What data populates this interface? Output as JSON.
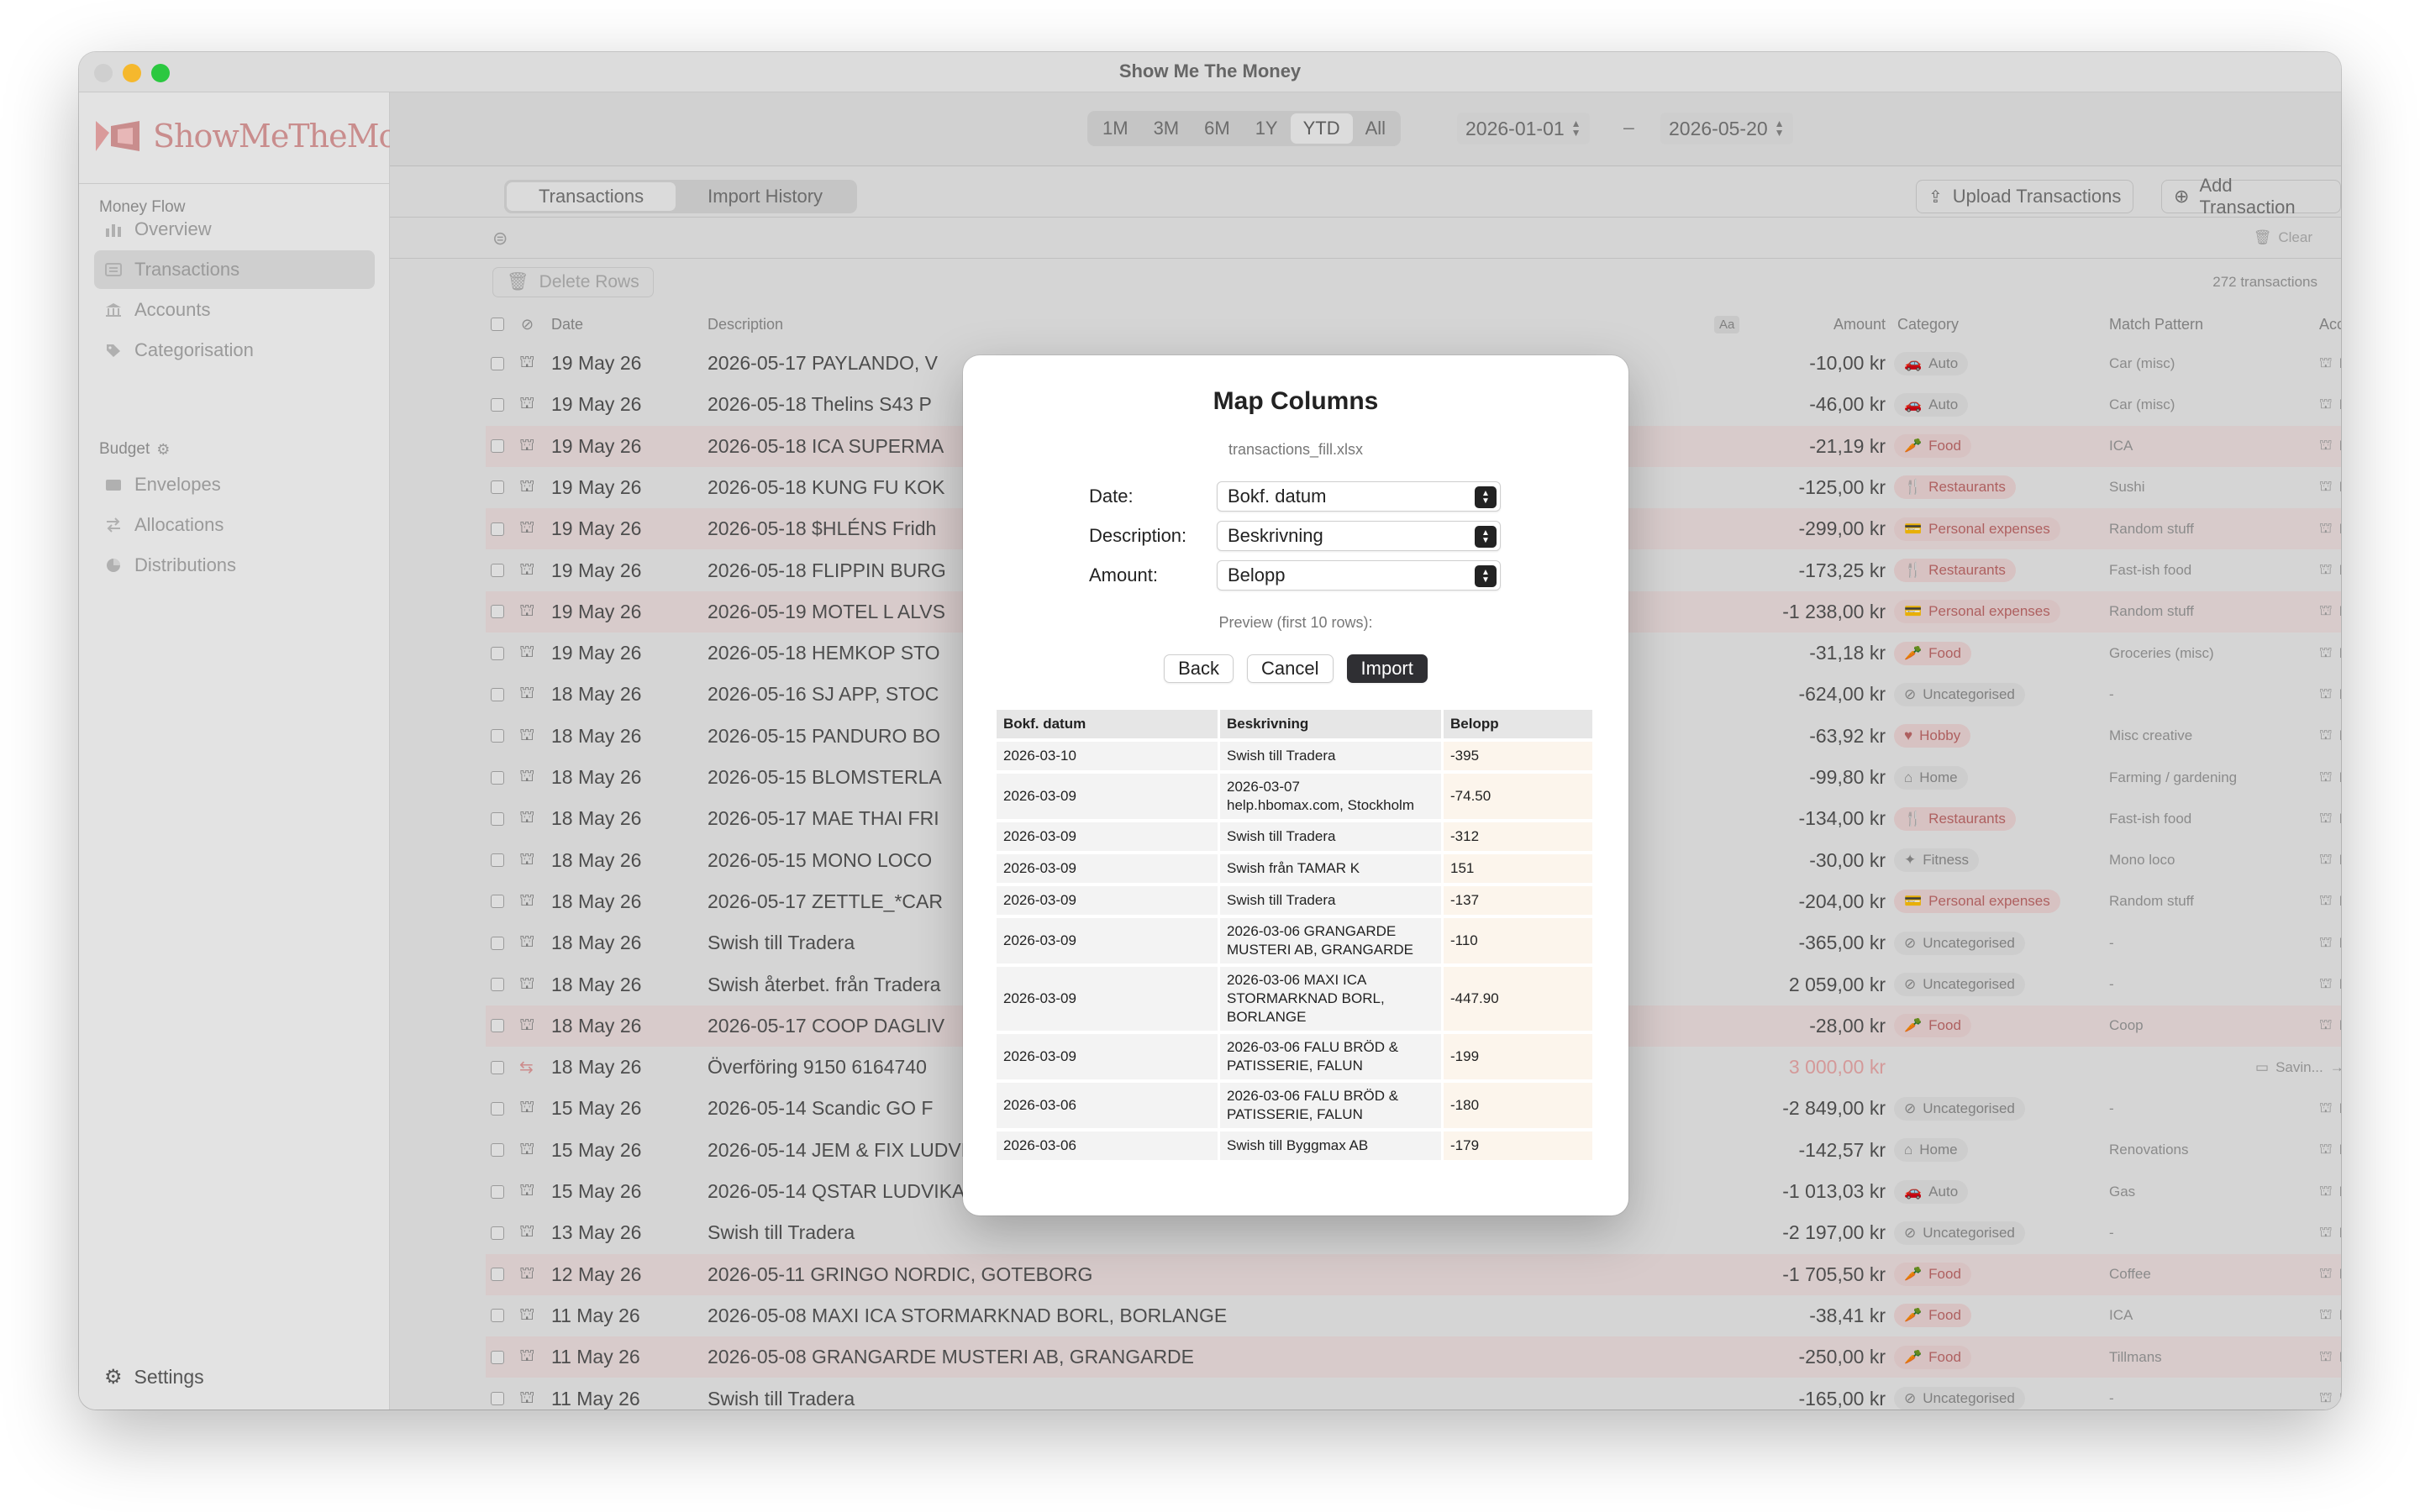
{
  "window": {
    "title": "Show Me The Money"
  },
  "sidebar": {
    "logo_text": "ShowMeTheMoney",
    "sections": [
      {
        "label": "Money Flow",
        "items": [
          {
            "label": "Overview",
            "icon": "chart-bars-icon"
          },
          {
            "label": "Transactions",
            "icon": "list-icon",
            "active": true
          },
          {
            "label": "Accounts",
            "icon": "bank-icon"
          },
          {
            "label": "Categorisation",
            "icon": "tag-icon"
          }
        ]
      },
      {
        "label": "Budget",
        "items": [
          {
            "label": "Envelopes",
            "icon": "envelope-icon"
          },
          {
            "label": "Allocations",
            "icon": "arrows-icon"
          },
          {
            "label": "Distributions",
            "icon": "pie-icon"
          }
        ]
      }
    ],
    "settings_label": "Settings"
  },
  "toolbar": {
    "ranges": [
      "1M",
      "3M",
      "6M",
      "1Y",
      "YTD",
      "All"
    ],
    "selected_range": "YTD",
    "date_from": "2026-01-01",
    "date_sep": "–",
    "date_to": "2026-05-20"
  },
  "tabs": {
    "transactions": "Transactions",
    "import_history": "Import History"
  },
  "actions": {
    "upload": "Upload Transactions",
    "add": "Add Transaction"
  },
  "filter": {
    "clear": "Clear"
  },
  "list": {
    "delete_label": "Delete Rows",
    "count": "272 transactions",
    "headers": {
      "date": "Date",
      "description": "Description",
      "aa": "Aa",
      "amount": "Amount",
      "category": "Category",
      "match": "Match Pattern",
      "account": "Account"
    },
    "rows": [
      {
        "date": "19 May 26",
        "desc": "2026-05-17 PAYLANDO, V",
        "amount": "-10,00 kr",
        "cat": "Auto",
        "match": "Car (misc)",
        "acct": "Debit",
        "pink": false,
        "red": false
      },
      {
        "date": "19 May 26",
        "desc": "2026-05-18 Thelins S43 P",
        "amount": "-46,00 kr",
        "cat": "Auto",
        "match": "Car (misc)",
        "acct": "Debit",
        "pink": false,
        "red": false
      },
      {
        "date": "19 May 26",
        "desc": "2026-05-18 ICA SUPERMA",
        "amount": "-21,19 kr",
        "cat": "Food",
        "match": "ICA",
        "acct": "Debit",
        "pink": true,
        "red": true
      },
      {
        "date": "19 May 26",
        "desc": "2026-05-18 KUNG FU KOK",
        "amount": "-125,00 kr",
        "cat": "Restaurants",
        "match": "Sushi",
        "acct": "Debit",
        "pink": false,
        "red": true
      },
      {
        "date": "19 May 26",
        "desc": "2026-05-18 $HLÉNS Fridh",
        "amount": "-299,00 kr",
        "cat": "Personal expenses",
        "match": "Random stuff",
        "acct": "Debit",
        "pink": true,
        "red": true
      },
      {
        "date": "19 May 26",
        "desc": "2026-05-18 FLIPPIN BURG",
        "amount": "-173,25 kr",
        "cat": "Restaurants",
        "match": "Fast-ish food",
        "acct": "Debit",
        "pink": false,
        "red": true
      },
      {
        "date": "19 May 26",
        "desc": "2026-05-19 MOTEL L ALVS",
        "amount": "-1 238,00 kr",
        "cat": "Personal expenses",
        "match": "Random stuff",
        "acct": "Debit",
        "pink": true,
        "red": true
      },
      {
        "date": "19 May 26",
        "desc": "2026-05-18 HEMKOP STO",
        "amount": "-31,18 kr",
        "cat": "Food",
        "match": "Groceries (misc)",
        "acct": "Debit",
        "pink": false,
        "red": true
      },
      {
        "date": "18 May 26",
        "desc": "2026-05-16 SJ APP, STOC",
        "amount": "-624,00 kr",
        "cat": "Uncategorised",
        "match": "-",
        "acct": "Debit",
        "pink": false,
        "red": false
      },
      {
        "date": "18 May 26",
        "desc": "2026-05-15 PANDURO BO",
        "amount": "-63,92 kr",
        "cat": "Hobby",
        "match": "Misc creative",
        "acct": "Debit",
        "pink": false,
        "red": true
      },
      {
        "date": "18 May 26",
        "desc": "2026-05-15 BLOMSTERLA",
        "amount": "-99,80 kr",
        "cat": "Home",
        "match": "Farming / gardening",
        "acct": "Debit",
        "pink": false,
        "red": false
      },
      {
        "date": "18 May 26",
        "desc": "2026-05-17 MAE THAI FRI",
        "amount": "-134,00 kr",
        "cat": "Restaurants",
        "match": "Fast-ish food",
        "acct": "Debit",
        "pink": false,
        "red": true
      },
      {
        "date": "18 May 26",
        "desc": "2026-05-15 MONO LOCO",
        "amount": "-30,00 kr",
        "cat": "Fitness",
        "match": "Mono loco",
        "acct": "Debit",
        "pink": false,
        "red": false
      },
      {
        "date": "18 May 26",
        "desc": "2026-05-17 ZETTLE_*CAR",
        "amount": "-204,00 kr",
        "cat": "Personal expenses",
        "match": "Random stuff",
        "acct": "Debit",
        "pink": false,
        "red": true
      },
      {
        "date": "18 May 26",
        "desc": "Swish till Tradera",
        "amount": "-365,00 kr",
        "cat": "Uncategorised",
        "match": "-",
        "acct": "Debit",
        "pink": false,
        "red": false
      },
      {
        "date": "18 May 26",
        "desc": "Swish återbet. från Tradera",
        "amount": "2 059,00 kr",
        "cat": "Uncategorised",
        "match": "-",
        "acct": "Debit",
        "pink": false,
        "red": false
      },
      {
        "date": "18 May 26",
        "desc": "2026-05-17 COOP DAGLIV",
        "amount": "-28,00 kr",
        "cat": "Food",
        "match": "Coop",
        "acct": "Debit",
        "pink": true,
        "red": true
      },
      {
        "date": "18 May 26",
        "desc": "Överföring 9150 6164740",
        "amount": "3 000,00 kr",
        "cat": "",
        "match": "",
        "acct": "Debit",
        "transfer_from": "Savin...",
        "pink": false,
        "red": false,
        "transfer": true
      },
      {
        "date": "15 May 26",
        "desc": "2026-05-14 Scandic GO F",
        "amount": "-2 849,00 kr",
        "cat": "Uncategorised",
        "match": "-",
        "acct": "Debit",
        "pink": false,
        "red": false
      },
      {
        "date": "15 May 26",
        "desc": "2026-05-14 JEM & FIX LUDVIKA, LUDVIKA",
        "amount": "-142,57 kr",
        "cat": "Home",
        "match": "Renovations",
        "acct": "Debit",
        "pink": false,
        "red": false
      },
      {
        "date": "15 May 26",
        "desc": "2026-05-14 QSTAR LUDVIKA 0391, LUDVIKA",
        "amount": "-1 013,03 kr",
        "cat": "Auto",
        "match": "Gas",
        "acct": "Debit",
        "pink": false,
        "red": false
      },
      {
        "date": "13 May 26",
        "desc": "Swish till Tradera",
        "amount": "-2 197,00 kr",
        "cat": "Uncategorised",
        "match": "-",
        "acct": "Debit",
        "pink": false,
        "red": false
      },
      {
        "date": "12 May 26",
        "desc": "2026-05-11 GRINGO NORDIC, GOTEBORG",
        "amount": "-1 705,50 kr",
        "cat": "Food",
        "match": "Coffee",
        "acct": "Debit",
        "pink": true,
        "red": true
      },
      {
        "date": "11 May 26",
        "desc": "2026-05-08 MAXI ICA STORMARKNAD BORL, BORLANGE",
        "amount": "-38,41 kr",
        "cat": "Food",
        "match": "ICA",
        "acct": "Debit",
        "pink": false,
        "red": true
      },
      {
        "date": "11 May 26",
        "desc": "2026-05-08 GRANGARDE MUSTERI AB, GRANGARDE",
        "amount": "-250,00 kr",
        "cat": "Food",
        "match": "Tillmans",
        "acct": "Debit",
        "pink": true,
        "red": true
      },
      {
        "date": "11 May 26",
        "desc": "Swish till Tradera",
        "amount": "-165,00 kr",
        "cat": "Uncategorised",
        "match": "-",
        "acct": "Debit",
        "pink": false,
        "red": false
      }
    ]
  },
  "modal": {
    "title": "Map Columns",
    "filename": "transactions_fill.xlsx",
    "fields": [
      {
        "label": "Date:",
        "value": "Bokf. datum"
      },
      {
        "label": "Description:",
        "value": "Beskrivning"
      },
      {
        "label": "Amount:",
        "value": "Belopp"
      }
    ],
    "preview_label": "Preview (first 10 rows):",
    "back": "Back",
    "cancel": "Cancel",
    "import": "Import",
    "preview": {
      "headers": [
        "Bokf. datum",
        "Beskrivning",
        "Belopp"
      ],
      "rows": [
        [
          "2026-03-10",
          "Swish till Tradera",
          "-395"
        ],
        [
          "2026-03-09",
          "2026-03-07\nhelp.hbomax.com, Stockholm",
          "-74.50"
        ],
        [
          "2026-03-09",
          "Swish till Tradera",
          "-312"
        ],
        [
          "2026-03-09",
          "Swish från TAMAR K",
          "151"
        ],
        [
          "2026-03-09",
          "Swish till Tradera",
          "-137"
        ],
        [
          "2026-03-09",
          "2026-03-06 GRANGARDE\nMUSTERI AB, GRANGARDE",
          "-110"
        ],
        [
          "2026-03-09",
          "2026-03-06 MAXI ICA\nSTORMARKNAD BORL,\nBORLANGE",
          "-447.90"
        ],
        [
          "2026-03-09",
          "2026-03-06 FALU BRÖD &\nPATISSERIE, FALUN",
          "-199"
        ],
        [
          "2026-03-06",
          "2026-03-06 FALU BRÖD &\nPATISSERIE, FALUN",
          "-180"
        ],
        [
          "2026-03-06",
          "Swish till Byggmax AB",
          "-179"
        ]
      ]
    }
  },
  "colors": {
    "expense_pink": "#eee0e0",
    "category_red": "#c06a6a",
    "transfer_amount": "#e9a9a9",
    "primary_button": "#2f2f33"
  }
}
